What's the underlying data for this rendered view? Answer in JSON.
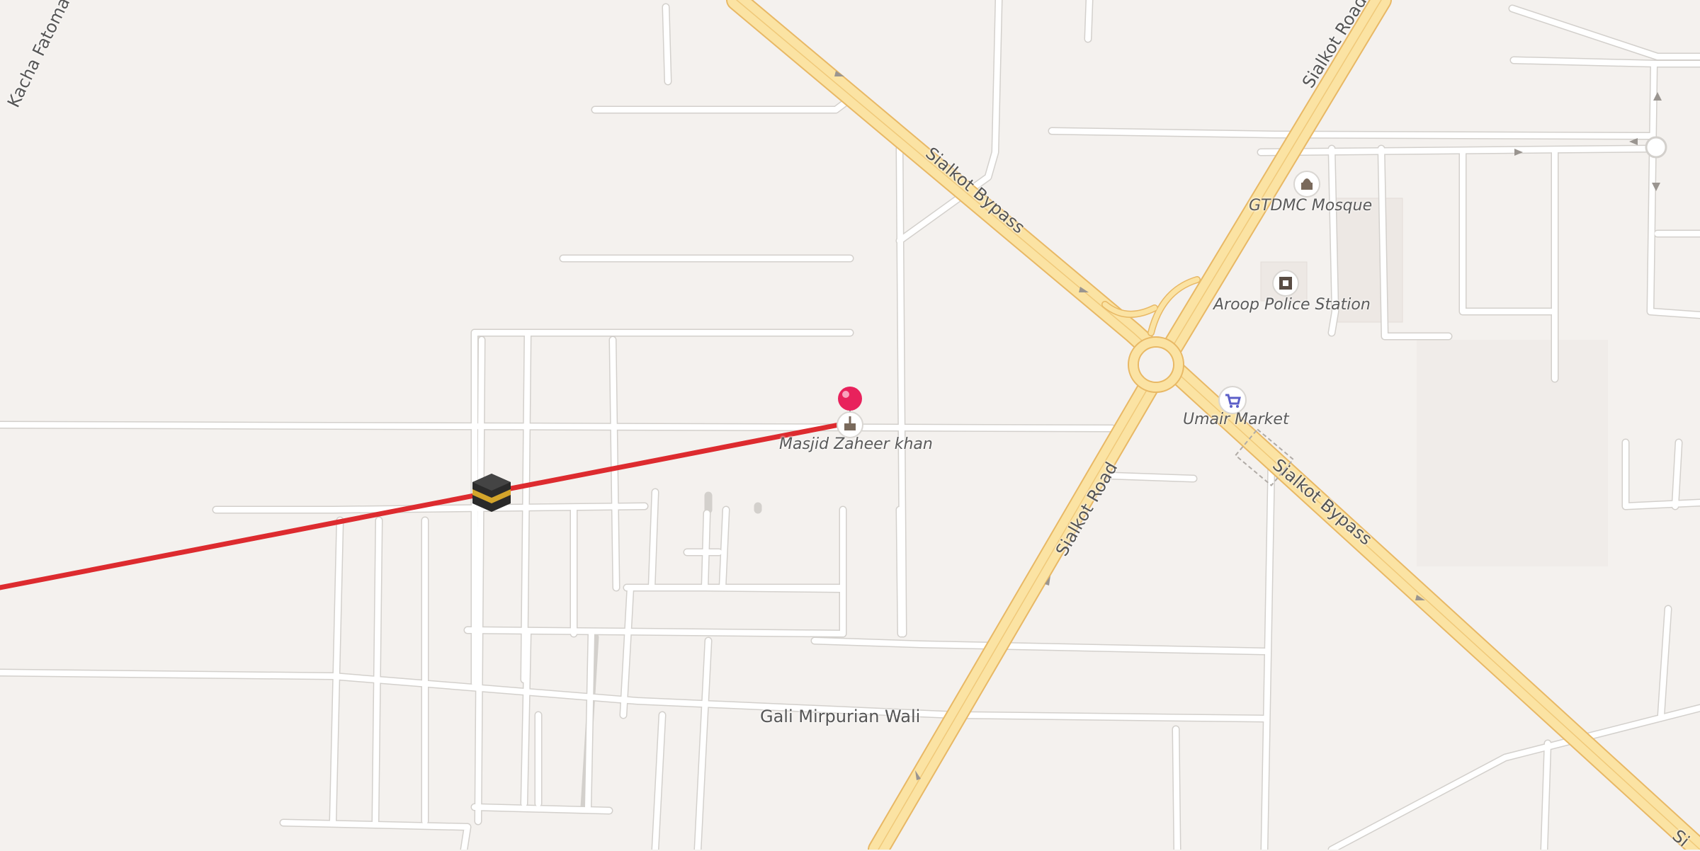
{
  "roads": {
    "sialkot_bypass_top": "Sialkot Bypass",
    "sialkot_bypass_bottom": "Sialkot Bypass",
    "sialkot_road_top": "Sialkot Road",
    "sialkot_road_mid": "Sialkot Road",
    "sialkot_road_corner": "Si",
    "kacha_fatoma": "Kacha Fatoma",
    "gali_mirpurian": "Gali Mirpurian Wali"
  },
  "pois": {
    "gtdmc_mosque": "GTDMC Mosque",
    "aroop_police": "Aroop Police Station",
    "umair_market": "Umair Market",
    "masjid_zaheer": "Masjid Zaheer khan"
  },
  "icons": {
    "pin": "location-pin-icon",
    "kaaba": "kaaba-icon",
    "mosque": "mosque-icon",
    "police": "police-icon",
    "cart": "shopping-cart-icon"
  },
  "colors": {
    "background": "#f4f1ee",
    "street": "#ffffff",
    "street_casing": "#d6d3cf",
    "highway": "#fbe3a3",
    "highway_casing": "#e8b865",
    "qibla_line": "#dd2b2f",
    "pin": "#e8225c",
    "cart_badge": "#5c5fc8"
  }
}
